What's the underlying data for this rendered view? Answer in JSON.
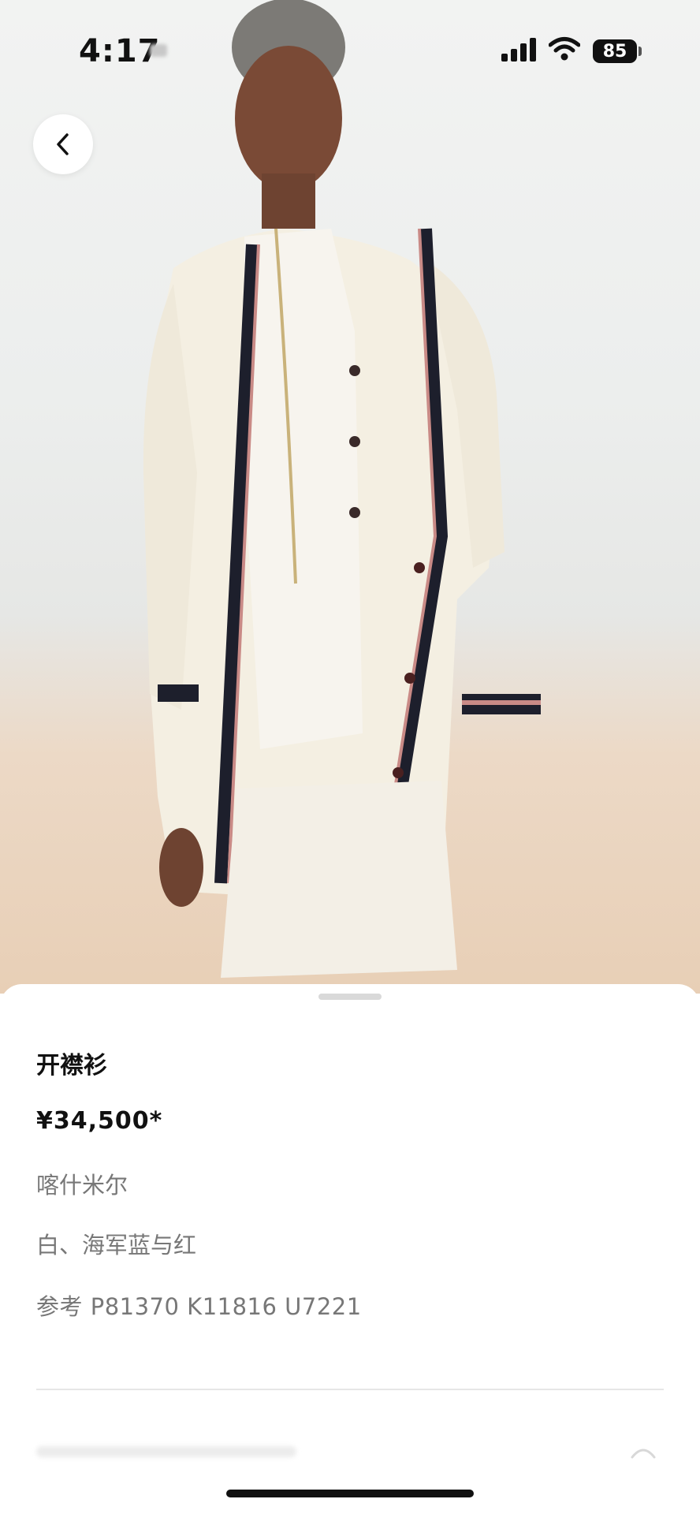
{
  "status_bar": {
    "time": "4:17",
    "battery": "85"
  },
  "product": {
    "title": "开襟衫",
    "price": "¥34,500*",
    "material": "喀什米尔",
    "color": "白、海军蓝与红",
    "reference": "参考 P81370 K11816 U7221"
  },
  "colors": {
    "cardigan": "#f4efe2",
    "trim_navy": "#1d1f2c",
    "trim_red": "#c98a86",
    "backdrop_sand": "#e8cfb6",
    "text_primary": "#111111",
    "text_secondary": "#777777"
  },
  "icons": {
    "back": "chevron-left-icon",
    "signal": "cellular-signal-icon",
    "wifi": "wifi-icon",
    "battery": "battery-icon"
  }
}
